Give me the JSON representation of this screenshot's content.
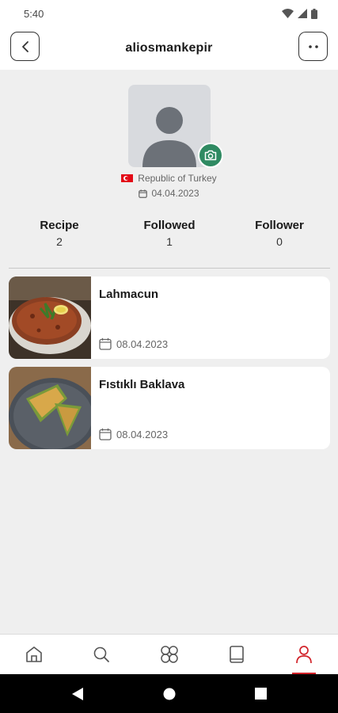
{
  "status_bar": {
    "time": "5:40"
  },
  "header": {
    "title": "aliosmankepir",
    "back_icon": "chevron-left-icon",
    "more_icon": "more-dots-icon"
  },
  "profile": {
    "country": "Republic of Turkey",
    "joined": "04.04.2023",
    "accent_color": "#2f8a62"
  },
  "stats": [
    {
      "label": "Recipe",
      "value": "2"
    },
    {
      "label": "Followed",
      "value": "1"
    },
    {
      "label": "Follower",
      "value": "0"
    }
  ],
  "recipes": [
    {
      "title": "Lahmacun",
      "date": "08.04.2023"
    },
    {
      "title": "Fıstıklı Baklava",
      "date": "08.04.2023"
    }
  ],
  "bottom_nav": {
    "items": [
      "home-icon",
      "search-icon",
      "categories-icon",
      "book-icon",
      "profile-icon"
    ],
    "active": "profile-icon",
    "active_color": "#d2232a"
  }
}
